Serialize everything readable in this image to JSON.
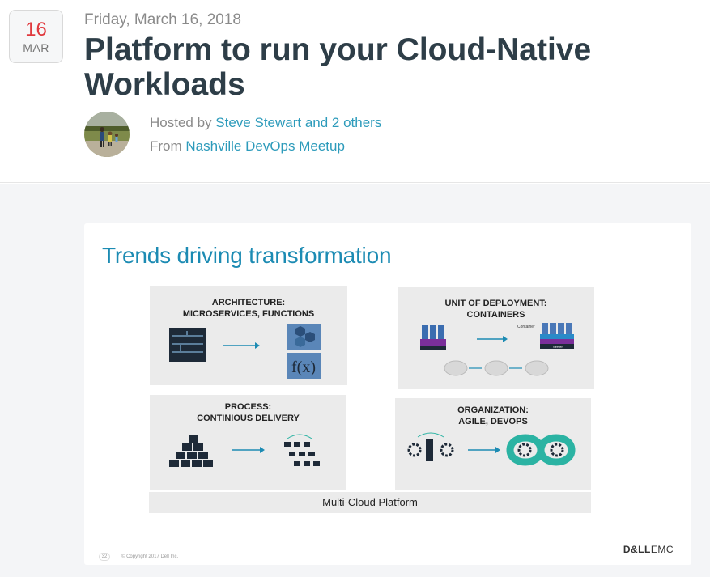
{
  "event": {
    "day": "16",
    "month": "MAR",
    "date_text": "Friday, March 16, 2018",
    "title": "Platform to run your Cloud-Native Workloads",
    "hosted_prefix": "Hosted by",
    "hosts_link": "Steve Stewart and 2 others",
    "from_prefix": "From",
    "group_link": "Nashville DevOps Meetup"
  },
  "slide": {
    "title": "Trends driving transformation",
    "panels": [
      {
        "title_line1": "ARCHITECTURE:",
        "title_line2": "MICROSERVICES, FUNCTIONS"
      },
      {
        "title_line1": "UNIT OF DEPLOYMENT:",
        "title_line2": "CONTAINERS"
      },
      {
        "title_line1": "PROCESS:",
        "title_line2": "CONTINIOUS DELIVERY"
      },
      {
        "title_line1": "ORGANIZATION:",
        "title_line2": "AGILE, DEVOPS"
      }
    ],
    "func_label": "f(x)",
    "container_label": "Container",
    "server_label": "Server",
    "footer_bar": "Multi-Cloud Platform",
    "page_number": "32",
    "copyright": "© Copyright 2017 Dell Inc.",
    "brand_bold": "D&LL",
    "brand_rest": "EMC"
  },
  "colors": {
    "accent_link": "#2d9bbb",
    "date_red": "#e0393e",
    "slide_title_blue": "#1c8bb3",
    "devops_teal": "#2bb3a3"
  }
}
